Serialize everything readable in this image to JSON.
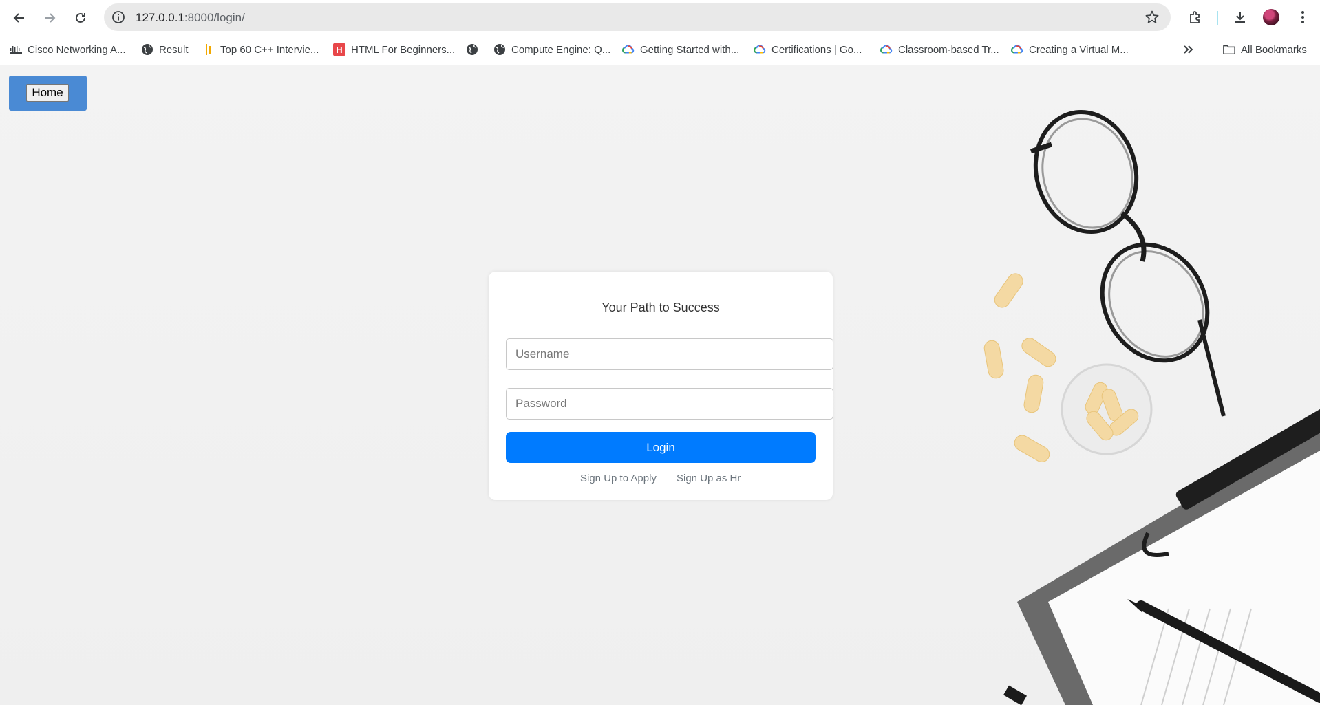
{
  "browser": {
    "url_host": "127.0.0.1",
    "url_path": ":8000/login/",
    "icons": {
      "back": "back-arrow-icon",
      "forward": "forward-arrow-icon",
      "reload": "reload-icon",
      "site_info": "info-icon",
      "bookmark_star": "star-icon",
      "extensions": "puzzle-icon",
      "downloads": "download-icon",
      "menu": "kebab-menu-icon"
    }
  },
  "bookmarks": {
    "items": [
      {
        "label": "Cisco Networking A...",
        "icon": "cisco-icon"
      },
      {
        "label": "Result",
        "icon": "globe-icon"
      },
      {
        "label": "Top 60 C++ Intervie...",
        "icon": "bar-icon"
      },
      {
        "label": "HTML For Beginners...",
        "icon": "h-logo-icon"
      },
      {
        "label": "",
        "icon": "globe-icon"
      },
      {
        "label": "Compute Engine: Q...",
        "icon": "globe-icon"
      },
      {
        "label": "Getting Started with...",
        "icon": "google-cloud-icon"
      },
      {
        "label": "Certifications | Go...",
        "icon": "google-cloud-icon"
      },
      {
        "label": "Classroom-based Tr...",
        "icon": "google-cloud-icon"
      },
      {
        "label": "Creating a Virtual M...",
        "icon": "google-cloud-icon"
      }
    ],
    "overflow_icon": "chevron-double-right-icon",
    "all_bookmarks_label": "All Bookmarks"
  },
  "page": {
    "home_button": "Home",
    "login_card": {
      "title": "Your Path to Success",
      "username_placeholder": "Username",
      "password_placeholder": "Password",
      "login_button": "Login",
      "signup_apply_link": "Sign Up to Apply",
      "signup_hr_link": "Sign Up as Hr"
    }
  },
  "colors": {
    "home_panel": "#4a8ad4",
    "login_button": "#007bff",
    "link": "#6c757d",
    "page_bg": "#f1f1f1"
  }
}
